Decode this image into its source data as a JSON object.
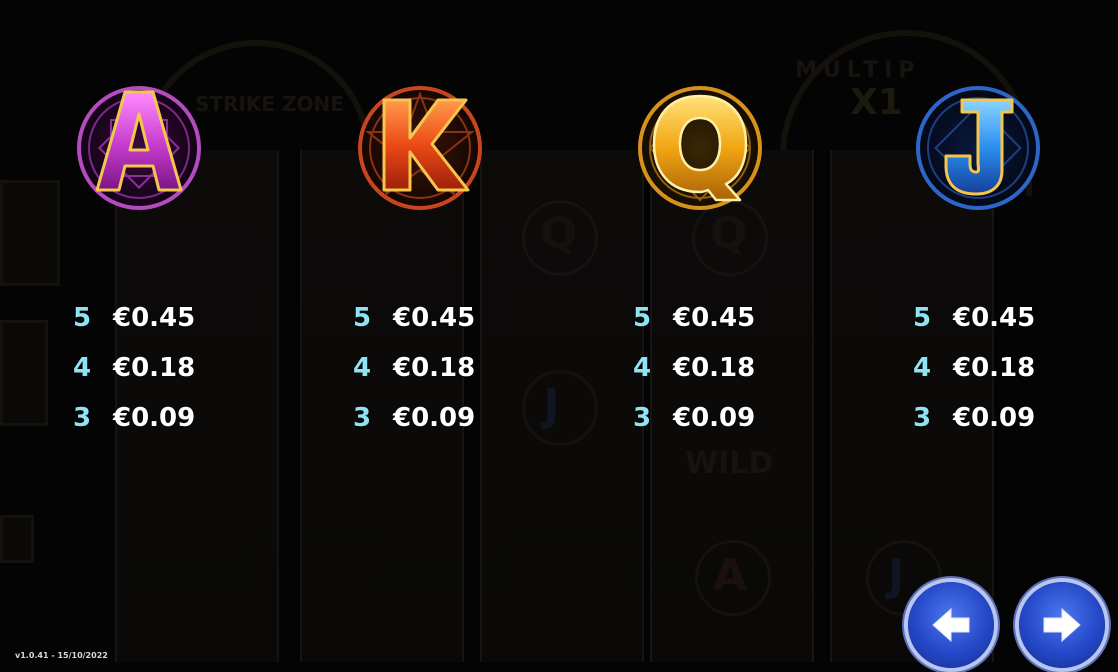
{
  "symbols": [
    {
      "letter": "A",
      "icon": "symbol-a-icon",
      "color": "#d24ad8",
      "ring": "#a43bb2",
      "pays": [
        {
          "count": "5",
          "value": "€0.45"
        },
        {
          "count": "4",
          "value": "€0.18"
        },
        {
          "count": "3",
          "value": "€0.09"
        }
      ]
    },
    {
      "letter": "K",
      "icon": "symbol-k-icon",
      "color": "#f0521e",
      "ring": "#c2421a",
      "pays": [
        {
          "count": "5",
          "value": "€0.45"
        },
        {
          "count": "4",
          "value": "€0.18"
        },
        {
          "count": "3",
          "value": "€0.09"
        }
      ]
    },
    {
      "letter": "Q",
      "icon": "symbol-q-icon",
      "color": "#f0a313",
      "ring": "#c88516",
      "pays": [
        {
          "count": "5",
          "value": "€0.45"
        },
        {
          "count": "4",
          "value": "€0.18"
        },
        {
          "count": "3",
          "value": "€0.09"
        }
      ]
    },
    {
      "letter": "J",
      "icon": "symbol-j-icon",
      "color": "#2f8ff0",
      "ring": "#2b62c8",
      "pays": [
        {
          "count": "5",
          "value": "€0.45"
        },
        {
          "count": "4",
          "value": "€0.18"
        },
        {
          "count": "3",
          "value": "€0.09"
        }
      ]
    }
  ],
  "nav": {
    "prev_icon": "arrow-left-icon",
    "next_icon": "arrow-right-icon"
  },
  "version": "v1.0.41 - 15/10/2022",
  "background": {
    "strike_zone": "STRIKE ZONE",
    "multiplier": "MULTIP",
    "multiplier_value": "X1",
    "wild": "WILD"
  }
}
